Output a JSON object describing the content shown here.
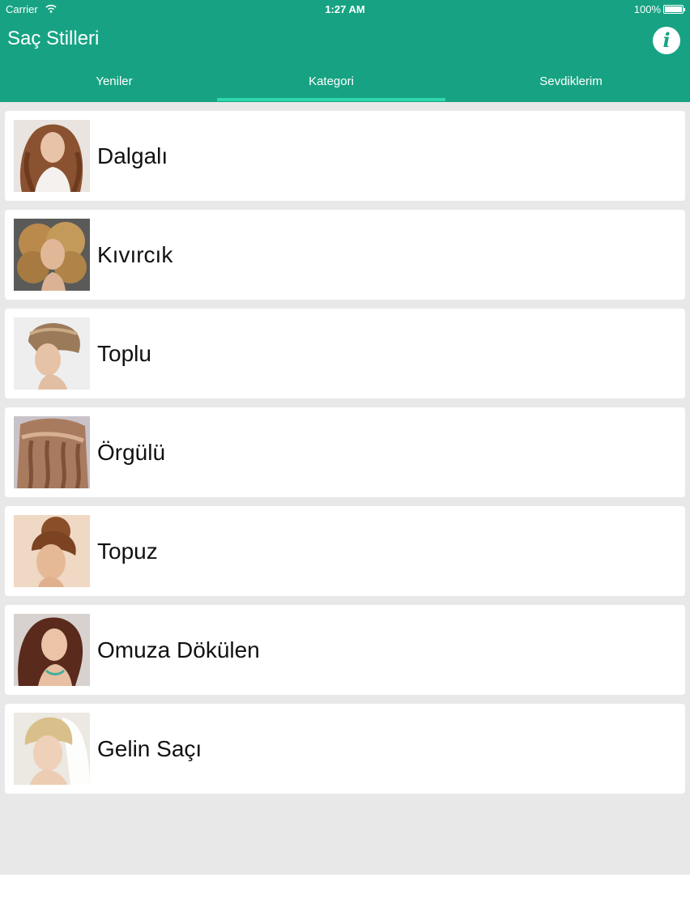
{
  "status": {
    "carrier": "Carrier",
    "time": "1:27 AM",
    "battery": "100%"
  },
  "header": {
    "title": "Saç Stilleri",
    "info_icon": "info-icon"
  },
  "tabs": [
    {
      "label": "Yeniler",
      "active": false
    },
    {
      "label": "Kategori",
      "active": true
    },
    {
      "label": "Sevdiklerim",
      "active": false
    }
  ],
  "categories": [
    {
      "label": "Dalgalı",
      "thumbnail": "wavy-hair-photo"
    },
    {
      "label": "Kıvırcık",
      "thumbnail": "curly-hair-photo"
    },
    {
      "label": "Toplu",
      "thumbnail": "updo-hair-photo"
    },
    {
      "label": "Örgülü",
      "thumbnail": "braided-hair-photo"
    },
    {
      "label": "Topuz",
      "thumbnail": "bun-hair-photo"
    },
    {
      "label": "Omuza Dökülen",
      "thumbnail": "shoulder-length-hair-photo"
    },
    {
      "label": "Gelin Saçı",
      "thumbnail": "bridal-hair-photo"
    }
  ],
  "colors": {
    "header": "#17a383",
    "tab_indicator": "#2fd6ad",
    "background": "#e8e8e9"
  }
}
